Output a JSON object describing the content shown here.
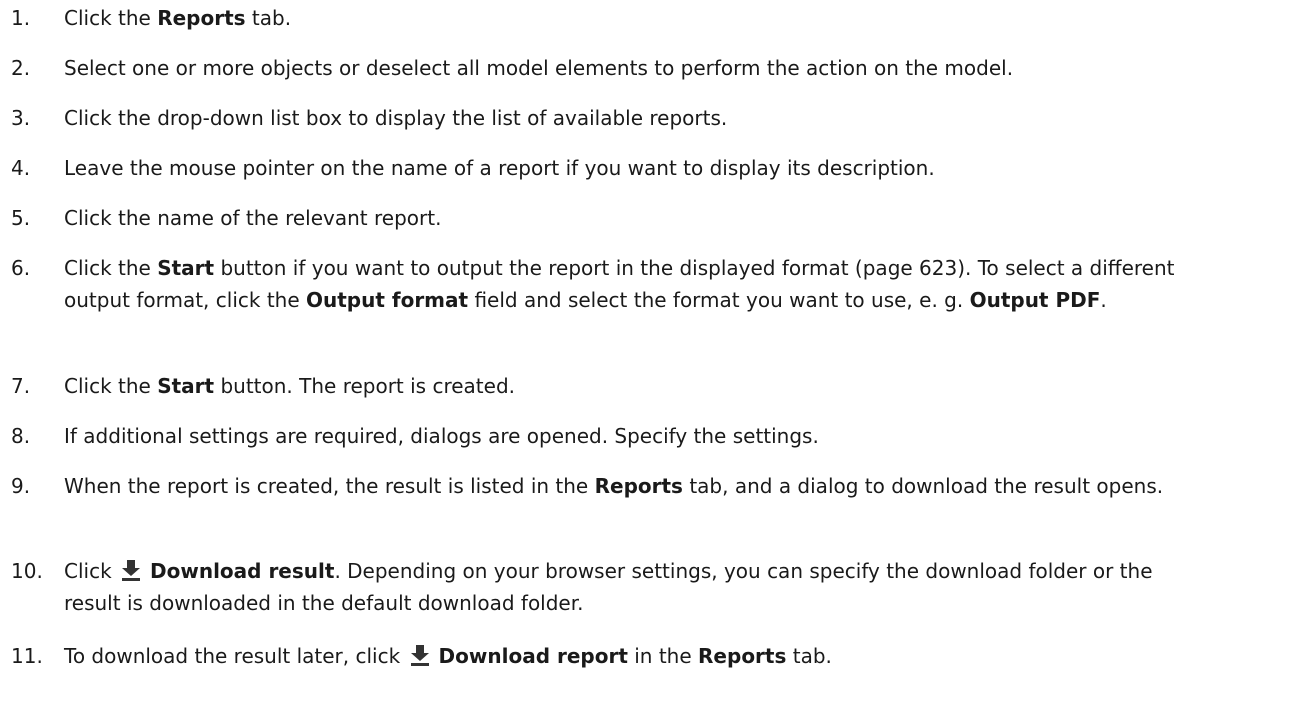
{
  "steps": [
    {
      "num": "1.",
      "segments": [
        {
          "t": "Click the "
        },
        {
          "t": "Reports",
          "b": true
        },
        {
          "t": " tab."
        }
      ]
    },
    {
      "num": "2.",
      "segments": [
        {
          "t": "Select one or more objects or deselect all model elements to perform the action on the model."
        }
      ]
    },
    {
      "num": "3.",
      "segments": [
        {
          "t": "Click the drop-down list box to display the list of available reports."
        }
      ]
    },
    {
      "num": "4.",
      "segments": [
        {
          "t": "Leave the mouse pointer on the name of a report if you want to display its description."
        }
      ]
    },
    {
      "num": "5.",
      "segments": [
        {
          "t": "Click the name of the relevant report."
        }
      ]
    },
    {
      "num": "6.",
      "segments": [
        {
          "t": "Click the "
        },
        {
          "t": "Start",
          "b": true
        },
        {
          "t": " button if you want to output the report in the displayed format (page 623). To select a different output format, click the "
        },
        {
          "t": "Output format",
          "b": true
        },
        {
          "t": " field and select the format you want to use, e. g. "
        },
        {
          "t": "Output PDF",
          "b": true
        },
        {
          "t": "."
        }
      ]
    },
    {
      "num": "7.",
      "segments": [
        {
          "t": "Click the "
        },
        {
          "t": "Start",
          "b": true
        },
        {
          "t": " button. The report is created."
        }
      ]
    },
    {
      "num": "8.",
      "segments": [
        {
          "t": "If additional settings are required, dialogs are opened. Specify the settings."
        }
      ]
    },
    {
      "num": "9.",
      "segments": [
        {
          "t": "When the report is created, the result is listed in the "
        },
        {
          "t": "Reports",
          "b": true
        },
        {
          "t": " tab, and a dialog to download the result opens."
        }
      ]
    },
    {
      "num": "10.",
      "segments": [
        {
          "t": "Click "
        },
        {
          "icon": "download-icon"
        },
        {
          "t": "Download result",
          "b": true
        },
        {
          "t": ". Depending on your browser settings, you can specify the download folder or the result is downloaded in the default download folder."
        }
      ]
    },
    {
      "num": "11.",
      "segments": [
        {
          "t": "To download the result later, click "
        },
        {
          "icon": "download-icon"
        },
        {
          "t": "Download report",
          "b": true
        },
        {
          "t": " in the "
        },
        {
          "t": "Reports",
          "b": true
        },
        {
          "t": " tab."
        }
      ]
    }
  ],
  "colors": {
    "text": "#1a1a1a",
    "icon": "#333333"
  }
}
